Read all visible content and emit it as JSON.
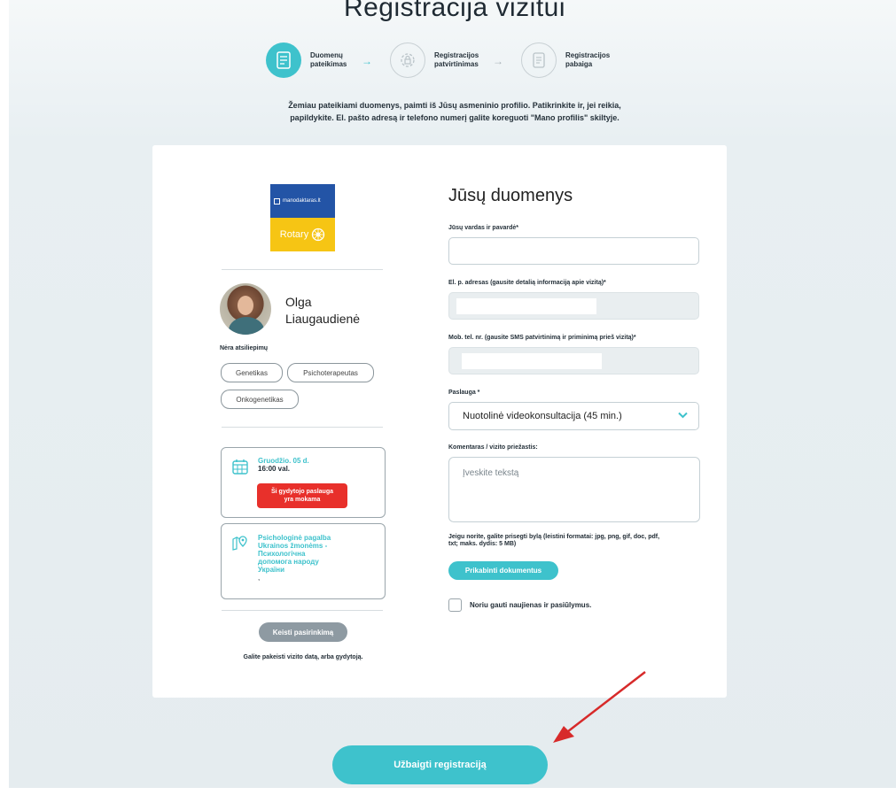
{
  "page": {
    "title": "Registracija vizitui",
    "intro_line1": "Žemiau pateikiami duomenys, paimti iš Jūsų asmeninio profilio. Patikrinkite ir, jei reikia,",
    "intro_line2": "papildykite. El. pašto adresą ir telefono numerį galite koreguoti \"Mano profilis\" skiltyje."
  },
  "steps": [
    {
      "line1": "Duomenų",
      "line2": "pateikimas",
      "icon": "form-icon",
      "state": "active"
    },
    {
      "line1": "Registracijos",
      "line2": "patvirtinimas",
      "icon": "lock-icon",
      "state": "inactive"
    },
    {
      "line1": "Registracijos",
      "line2": "pabaiga",
      "icon": "document-icon",
      "state": "inactive"
    }
  ],
  "logo": {
    "top_text": "manodaktaras.lt",
    "bottom_text": "Rotary",
    "colors": {
      "top": "#2354a6",
      "bottom": "#f6c514"
    }
  },
  "doctor": {
    "first_name": "Olga",
    "last_name": "Liaugaudienė",
    "reviews": "Nėra atsiliepimų",
    "specialties": [
      "Genetikas",
      "Psichoterapeutas",
      "Onkogenetikas"
    ]
  },
  "visit": {
    "date": "Gruodžio. 05 d.",
    "time": "16:00 val.",
    "paid_notice_line1": "Ši gydytojo paslauga",
    "paid_notice_line2": "yra mokama"
  },
  "location": {
    "lines": [
      "Psichologinė pagalba",
      "Ukrainos žmonėms -",
      "Психологічна",
      "допомога народу",
      "України"
    ],
    "extra": ","
  },
  "change": {
    "button": "Keisti pasirinkimą",
    "note": "Galite pakeisti vizito datą, arba gydytoją."
  },
  "form": {
    "title": "Jūsų duomenys",
    "name_label": "Jūsų vardas ir pavardė*",
    "email_label": "El. p. adresas (gausite detalią informaciją apie vizitą)*",
    "phone_label": "Mob. tel. nr. (gausite SMS patvirtinimą ir priminimą prieš vizitą)*",
    "service_label": "Paslauga *",
    "service_value": "Nuotolinė videokonsultacija (45 min.)",
    "comment_label": "Komentaras / vizito priežastis:",
    "comment_placeholder": "Įveskite tekstą",
    "attach_note_line1": "Jeigu norite, galite prisegti bylą (leistini formatai: jpg, png, gif, doc, pdf,",
    "attach_note_line2": "txt; maks. dydis: 5 MB)",
    "attach_button": "Prikabinti dokumentus",
    "newsletter_label": "Noriu gauti naujienas ir pasiūlymus."
  },
  "submit": {
    "label": "Užbaigti registraciją"
  },
  "colors": {
    "accent": "#3ec2cc",
    "danger": "#e8302b",
    "annotation_arrow": "#d72a2a"
  }
}
